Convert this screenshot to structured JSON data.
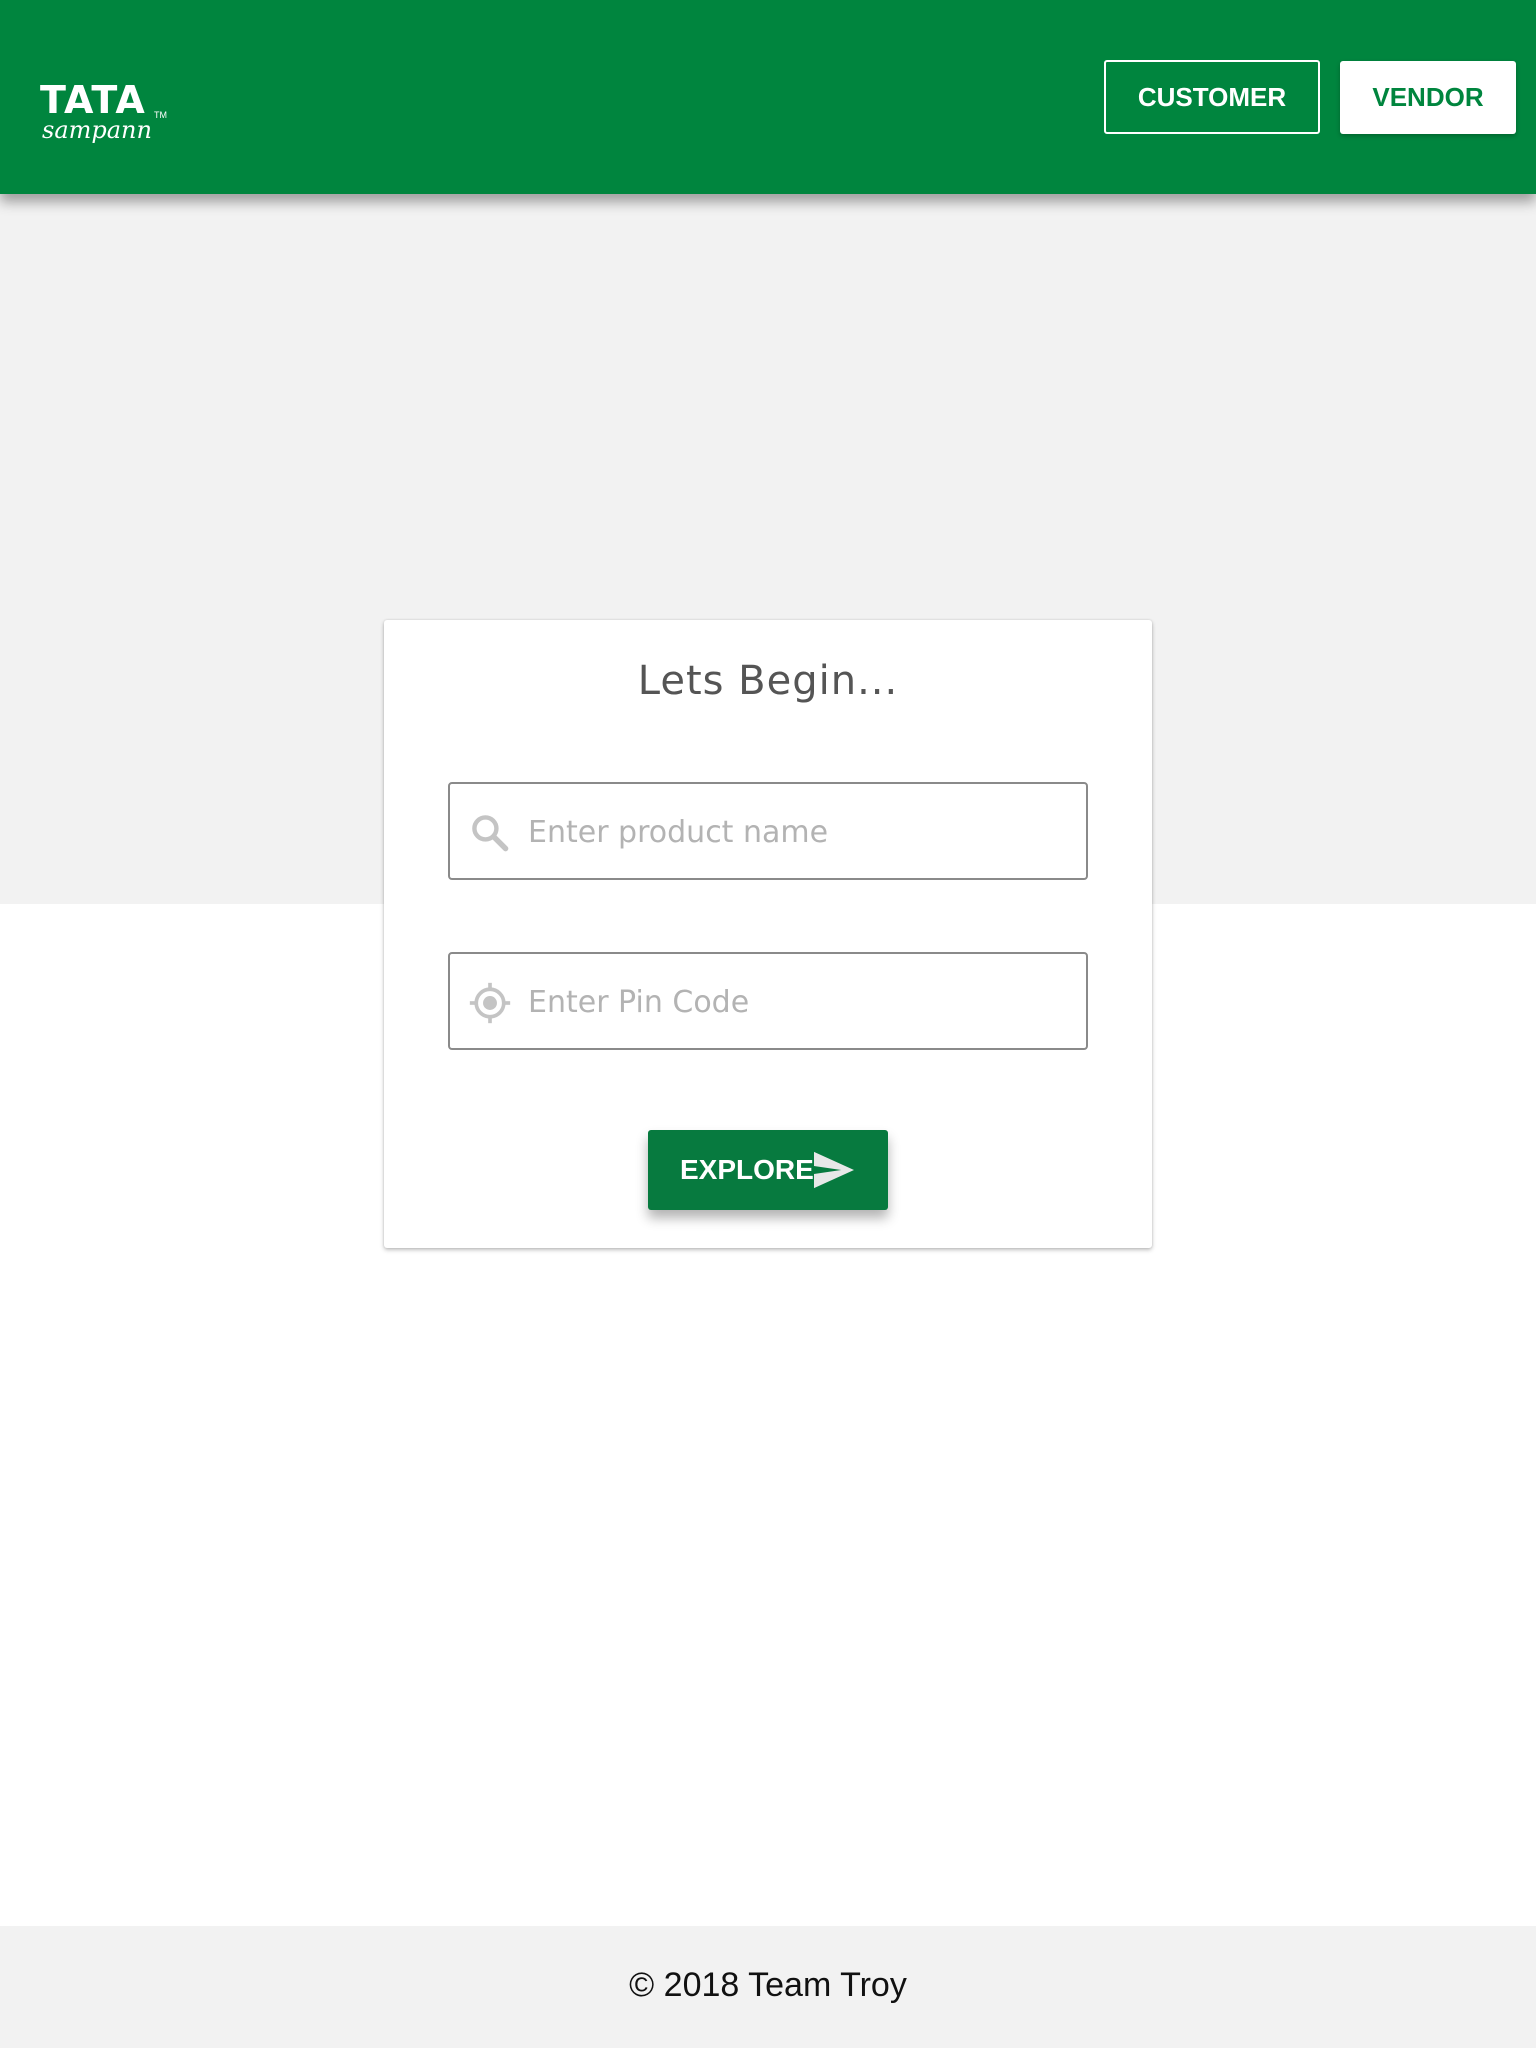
{
  "header": {
    "logo": {
      "line1": "TATA",
      "line2": "sampann",
      "trademark": "TM"
    },
    "buttons": {
      "customer_label": "CUSTOMER",
      "vendor_label": "VENDOR"
    }
  },
  "card": {
    "title": "Lets Begin...",
    "product_input": {
      "placeholder": "Enter product name",
      "value": "",
      "icon": "search-icon"
    },
    "pin_input": {
      "placeholder": "Enter Pin Code",
      "value": "",
      "icon": "location-target-icon"
    },
    "explore_button": {
      "label": "EXPLORE",
      "icon": "send-icon"
    }
  },
  "footer": {
    "text": "© 2018 Team Troy"
  },
  "colors": {
    "brand_green": "#00853e",
    "button_green": "#077a3f",
    "band_grey": "#f2f2f2"
  }
}
